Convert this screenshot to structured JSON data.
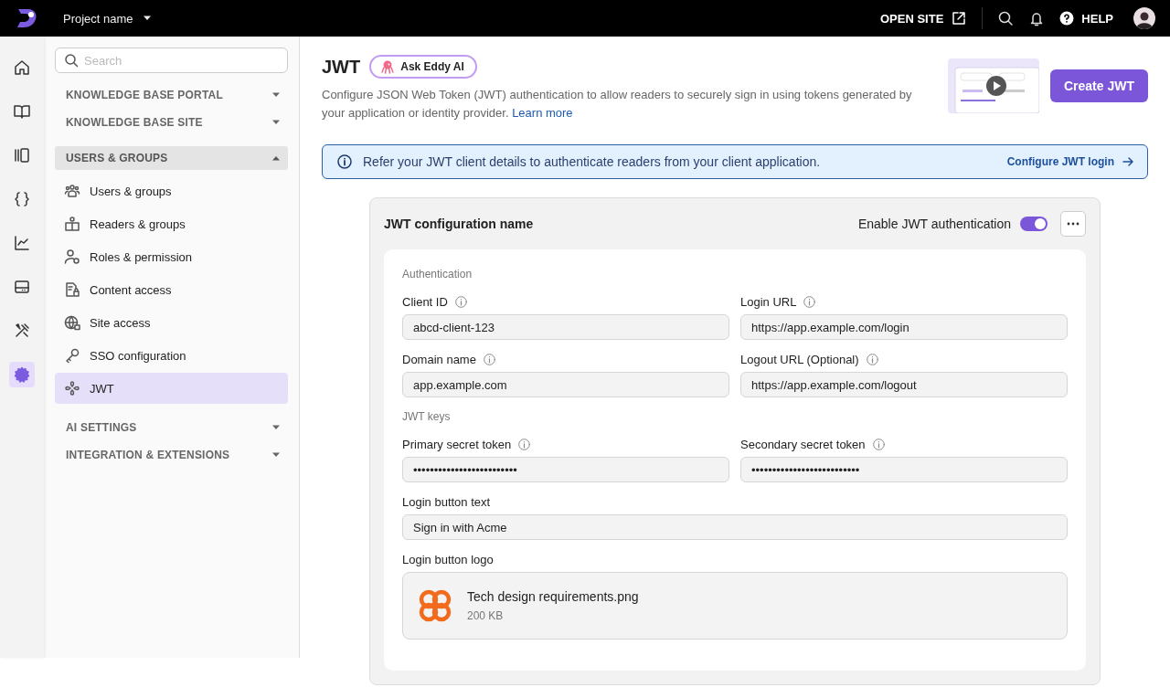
{
  "topbar": {
    "project": "Project name",
    "open_site": "OPEN SITE",
    "help": "HELP"
  },
  "rail": [
    {
      "selected": false
    },
    {
      "selected": false
    },
    {
      "selected": false
    },
    {
      "selected": false
    },
    {
      "selected": false
    },
    {
      "selected": false
    },
    {
      "selected": false
    },
    {
      "selected": true
    }
  ],
  "sidebar": {
    "search": {
      "placeholder": "Search"
    },
    "sections": [
      {
        "title": "KNOWLEDGE BASE PORTAL",
        "expanded": false
      },
      {
        "title": "KNOWLEDGE BASE SITE",
        "expanded": false
      },
      {
        "title": "USERS & GROUPS",
        "expanded": true,
        "items": [
          {
            "label": "Users & groups",
            "selected": false
          },
          {
            "label": "Readers & groups",
            "selected": false
          },
          {
            "label": "Roles & permission",
            "selected": false
          },
          {
            "label": "Content access",
            "selected": false
          },
          {
            "label": "Site access",
            "selected": false
          },
          {
            "label": "SSO configuration",
            "selected": false
          },
          {
            "label": "JWT",
            "selected": true
          }
        ]
      },
      {
        "title": "AI SETTINGS",
        "expanded": false
      },
      {
        "title": "INTEGRATION & EXTENSIONS",
        "expanded": false
      }
    ]
  },
  "header": {
    "title": "JWT",
    "ai_button": "Ask Eddy AI",
    "description": "Configure JSON Web Token (JWT) authentication to allow readers to securely sign in using tokens generated by your application or identity provider.",
    "learn_more": "Learn more",
    "create_button": "Create JWT"
  },
  "banner": {
    "text": "Refer your JWT client details to authenticate readers from your client application.",
    "link": "Configure JWT login"
  },
  "card": {
    "title": "JWT configuration name",
    "toggle_label": "Enable JWT authentication",
    "enabled": true,
    "sections": [
      {
        "heading": "Authentication",
        "fields": [
          {
            "kind": "half",
            "label": "Client ID",
            "info": true,
            "value": "abcd-client-123"
          },
          {
            "kind": "half",
            "label": "Login URL",
            "info": true,
            "value": "https://app.example.com/login"
          },
          {
            "kind": "half",
            "label": "Domain name",
            "info": true,
            "value": "app.example.com"
          },
          {
            "kind": "half",
            "label": "Logout URL (Optional)",
            "info": true,
            "value": "https://app.example.com/logout"
          }
        ]
      },
      {
        "heading": "JWT keys",
        "fields": [
          {
            "kind": "half",
            "label": "Primary secret token",
            "info": true,
            "value": "•••••••••••••••••••••••••"
          },
          {
            "kind": "half",
            "label": "Secondary secret token",
            "info": true,
            "value": "••••••••••••••••••••••••••"
          },
          {
            "kind": "full",
            "label": "Login button text",
            "info": false,
            "value": "Sign in with Acme"
          },
          {
            "kind": "file",
            "label": "Login button logo",
            "file_name": "Tech design requirements.png",
            "file_size": "200 KB"
          }
        ]
      }
    ]
  }
}
